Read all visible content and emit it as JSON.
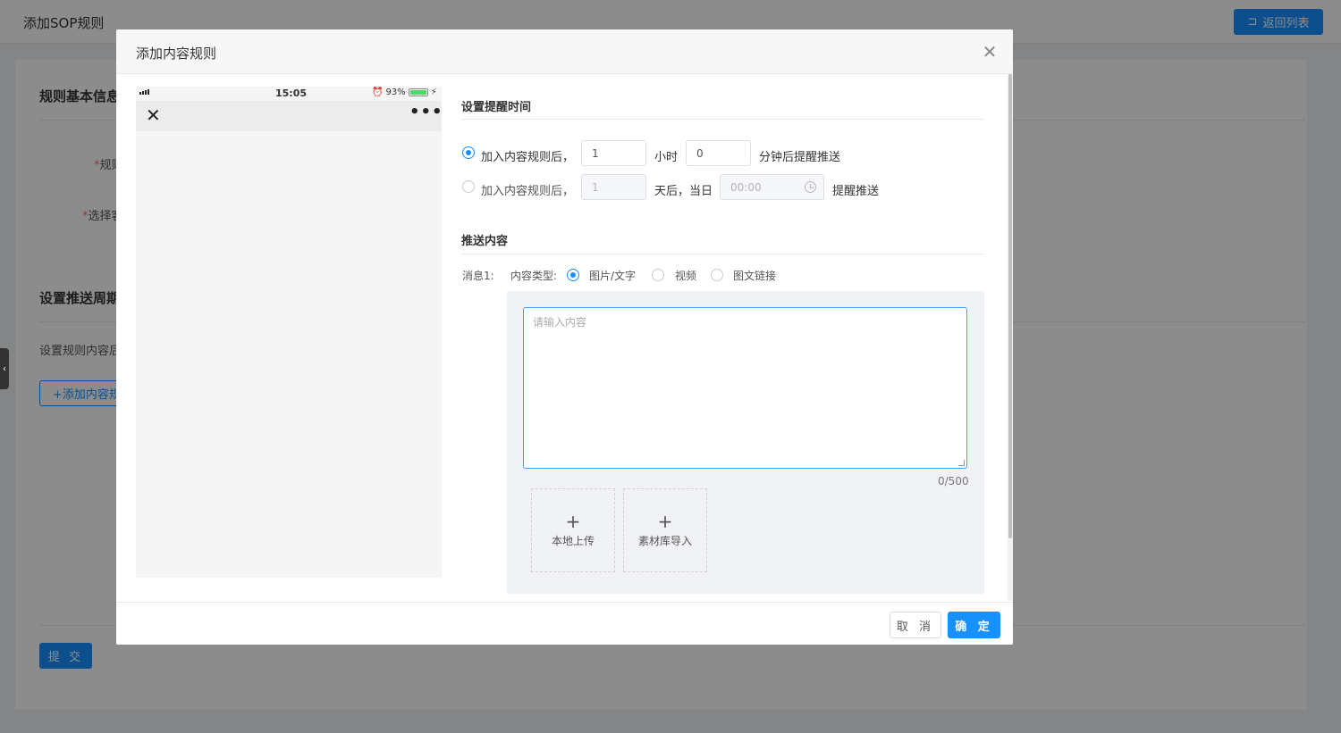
{
  "page": {
    "title": "添加SOP规则",
    "back_button": "返回列表",
    "section_basic": "规则基本信息",
    "label_rule": "规则",
    "label_select": "选择客",
    "section_cycle": "设置推送周期",
    "label_rule_content": "设置规则内容后",
    "add_rule_button": "+添加内容规",
    "submit_button": "提 交"
  },
  "modal": {
    "title": "添加内容规则",
    "cancel_button": "取 消",
    "ok_button": "确 定"
  },
  "phone": {
    "time": "15:05",
    "battery": "93%"
  },
  "form": {
    "remind_section": "设置提醒时间",
    "option1": {
      "prefix": "加入内容规则后，",
      "hours_value": "1",
      "hours_unit": "小时",
      "minutes_value": "0",
      "suffix": "分钟后提醒推送",
      "selected": true
    },
    "option2": {
      "prefix": "加入内容规则后，",
      "days_value": "1",
      "days_unit": "天后，当日",
      "time_placeholder": "00:00",
      "suffix": "提醒推送",
      "selected": false
    },
    "push_section": "推送内容",
    "message_label": "消息1:",
    "content_type_label": "内容类型:",
    "content_types": [
      "图片/文字",
      "视频",
      "图文链接"
    ],
    "selected_type": "图片/文字",
    "textarea_placeholder": "请输入内容",
    "counter": "0/500",
    "upload_local": "本地上传",
    "upload_library": "素材库导入"
  },
  "colors": {
    "primary": "#1890ff",
    "focus_border": "#409eff"
  }
}
